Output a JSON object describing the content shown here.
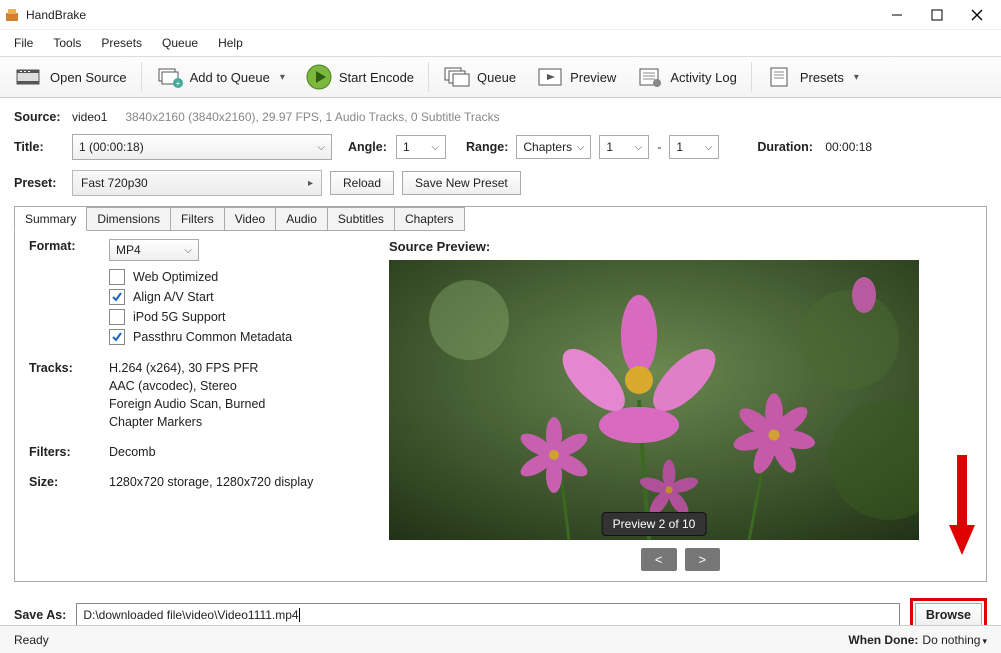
{
  "titlebar": {
    "app_name": "HandBrake"
  },
  "menu": {
    "file": "File",
    "tools": "Tools",
    "presets": "Presets",
    "queue": "Queue",
    "help": "Help"
  },
  "toolbar": {
    "open_source": "Open Source",
    "add_queue": "Add to Queue",
    "start_encode": "Start Encode",
    "queue": "Queue",
    "preview": "Preview",
    "activity": "Activity Log",
    "presets": "Presets"
  },
  "source": {
    "label": "Source:",
    "name": "video1",
    "info": "3840x2160 (3840x2160), 29.97 FPS, 1 Audio Tracks, 0 Subtitle Tracks"
  },
  "title": {
    "label": "Title:",
    "value": "1  (00:00:18)",
    "angle_label": "Angle:",
    "angle_value": "1",
    "range_label": "Range:",
    "range_mode": "Chapters",
    "range_from": "1",
    "range_to": "1",
    "dash": "-",
    "duration_label": "Duration:",
    "duration_value": "00:00:18"
  },
  "preset": {
    "label": "Preset:",
    "value": "Fast 720p30",
    "reload": "Reload",
    "save_new": "Save New Preset"
  },
  "tabs": {
    "summary": "Summary",
    "dimensions": "Dimensions",
    "filters": "Filters",
    "video": "Video",
    "audio": "Audio",
    "subtitles": "Subtitles",
    "chapters": "Chapters"
  },
  "summary": {
    "format_label": "Format:",
    "format_value": "MP4",
    "opt_web": "Web Optimized",
    "opt_av": "Align A/V Start",
    "opt_ipod": "iPod 5G Support",
    "opt_meta": "Passthru Common Metadata",
    "tracks_label": "Tracks:",
    "tracks_1": "H.264 (x264), 30 FPS PFR",
    "tracks_2": "AAC (avcodec), Stereo",
    "tracks_3": "Foreign Audio Scan, Burned",
    "tracks_4": "Chapter Markers",
    "filters_label": "Filters:",
    "filters_value": "Decomb",
    "size_label": "Size:",
    "size_value": "1280x720 storage, 1280x720 display",
    "preview_title": "Source Preview:",
    "preview_badge": "Preview 2 of 10",
    "nav_prev": "<",
    "nav_next": ">"
  },
  "saveas": {
    "label": "Save As:",
    "path": "D:\\downloaded file\\video\\Video1111.mp4",
    "browse": "Browse"
  },
  "status": {
    "ready": "Ready",
    "when_done_label": "When Done:",
    "when_done_value": "Do nothing"
  }
}
